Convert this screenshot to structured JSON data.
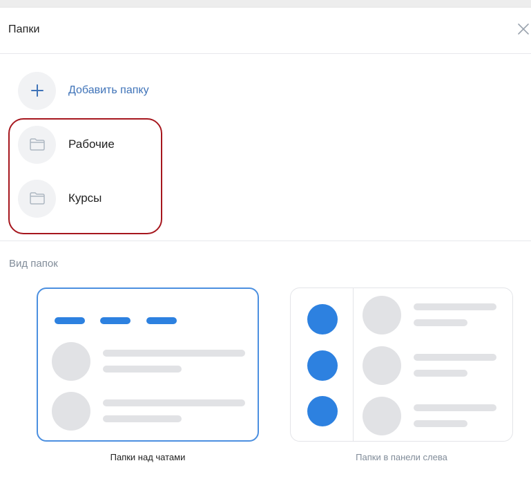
{
  "dialog": {
    "title": "Папки",
    "close_icon": "close-icon"
  },
  "folders": {
    "add_label": "Добавить папку",
    "add_icon": "plus-icon",
    "items": [
      {
        "label": "Рабочие",
        "icon": "folder-icon"
      },
      {
        "label": "Курсы",
        "icon": "folder-icon"
      }
    ]
  },
  "view": {
    "section_title": "Вид папок",
    "options": [
      {
        "label": "Папки над чатами",
        "selected": true
      },
      {
        "label": "Папки в панели слева",
        "selected": false
      }
    ]
  },
  "colors": {
    "accent": "#2d81e0",
    "link": "#3f73b8",
    "highlight_border": "#a6161d",
    "placeholder": "#e1e2e5"
  }
}
